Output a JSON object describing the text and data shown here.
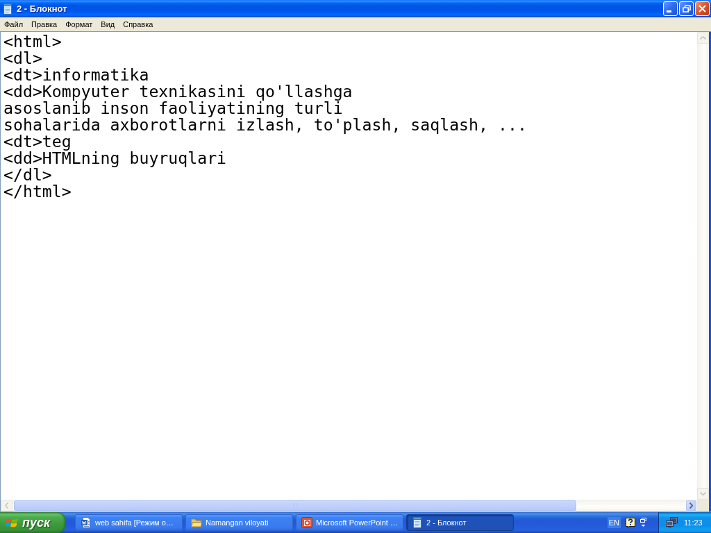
{
  "window": {
    "title": "2 - Блокнот"
  },
  "menu": [
    "Файл",
    "Правка",
    "Формат",
    "Вид",
    "Справка"
  ],
  "editor": {
    "lines": [
      "<html>",
      "<dl>",
      "<dt>informatika",
      "<dd>Kompyuter texnikasini qo'llashga",
      "asoslanib inson faoliyatining turli",
      "sohalarida axborotlarni izlash, to'plash, saqlash, ...",
      "<dt>teg",
      "<dd>HTMLning buyruqlari",
      "</dl>",
      "</html>"
    ]
  },
  "taskbar": {
    "start_button": "пуск",
    "tasks": [
      {
        "label": "web sahifa [Режим о…",
        "kind": "document",
        "selected": false
      },
      {
        "label": "Namangan viloyati",
        "kind": "folder",
        "selected": false
      },
      {
        "label": "Microsoft PowerPoint …",
        "kind": "presentation",
        "selected": false
      },
      {
        "label": "2 - Блокнот",
        "kind": "notepad",
        "selected": true
      }
    ],
    "language": "EN",
    "clock": "11:23"
  }
}
